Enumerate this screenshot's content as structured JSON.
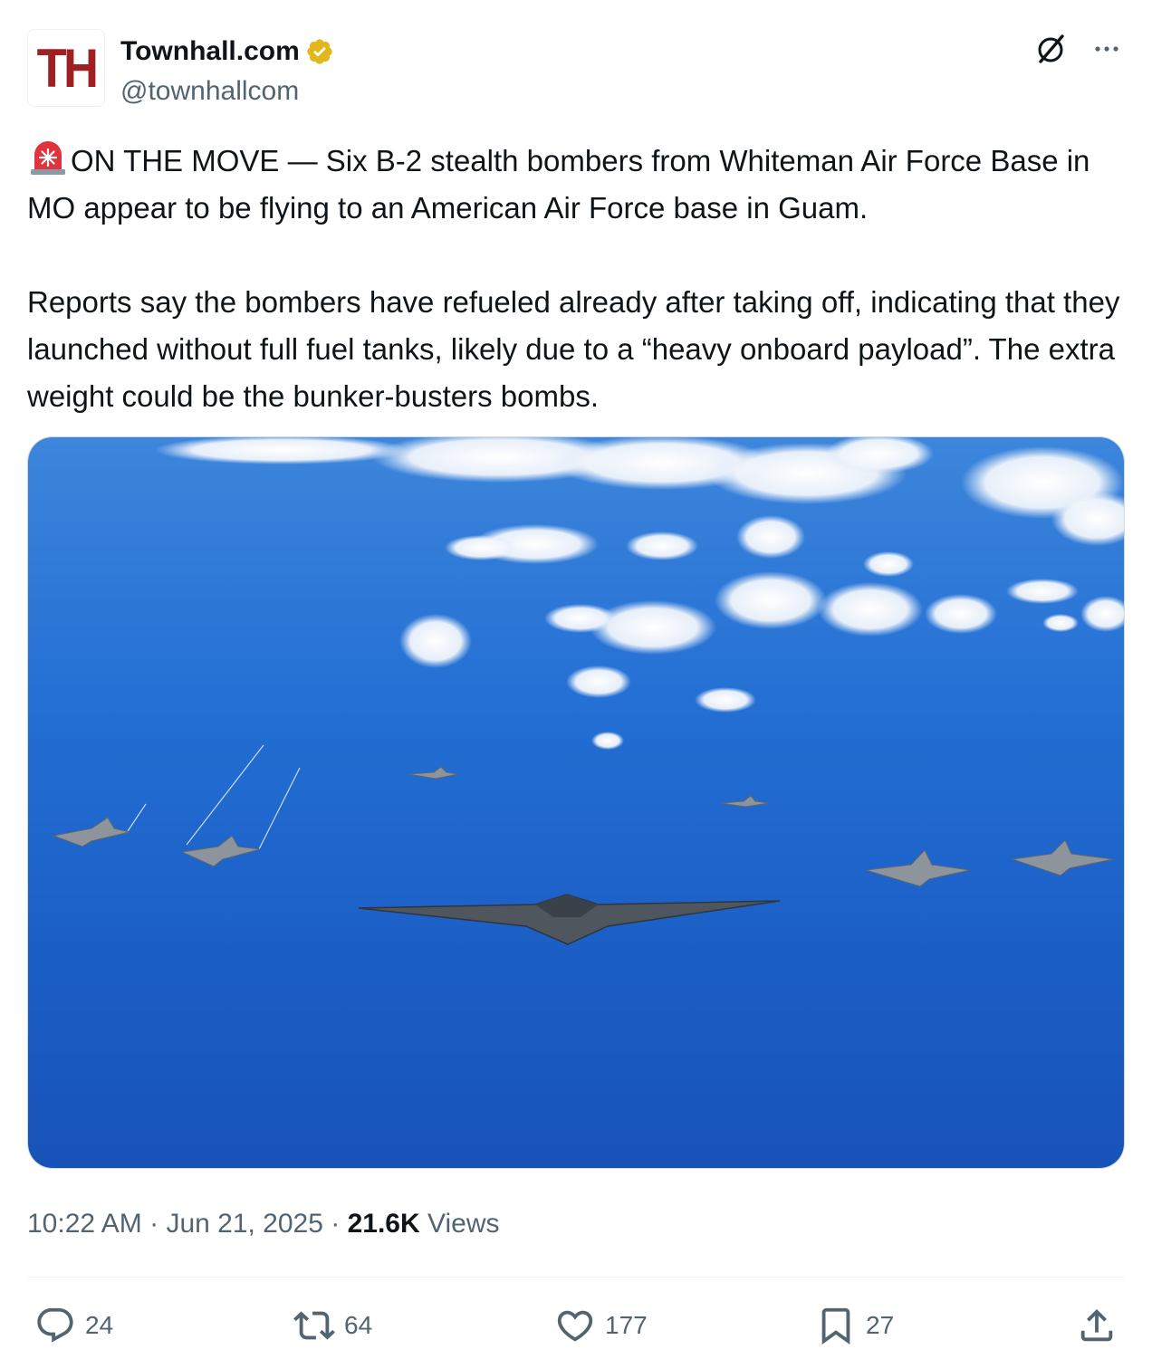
{
  "author": {
    "avatar_text": "TH",
    "display_name": "Townhall.com",
    "handle": "@townhallcom",
    "verified_color": "#e2b719"
  },
  "header_icons": [
    "grok-icon",
    "more-icon"
  ],
  "tweet": {
    "paragraph1": "ON THE MOVE — Six B-2 stealth bombers from Whiteman Air Force Base in MO appear to be flying to an American Air Force base in Guam.",
    "paragraph2": "Reports say the bombers have refueled already after taking off, indicating that they launched without full fuel tanks, likely due to a “heavy onboard payload”. The extra weight could be the bunker-busters bombs."
  },
  "meta": {
    "time": "10:22 AM",
    "date": "Jun 21, 2025",
    "separator": " · ",
    "views_count": "21.6K",
    "views_label": "Views"
  },
  "actions": {
    "replies": "24",
    "reposts": "64",
    "likes": "177",
    "bookmarks": "27"
  },
  "colors": {
    "text": "#0f1419",
    "secondary": "#536471",
    "brand": "#a01f22",
    "ocean": "#1f5fc4"
  }
}
